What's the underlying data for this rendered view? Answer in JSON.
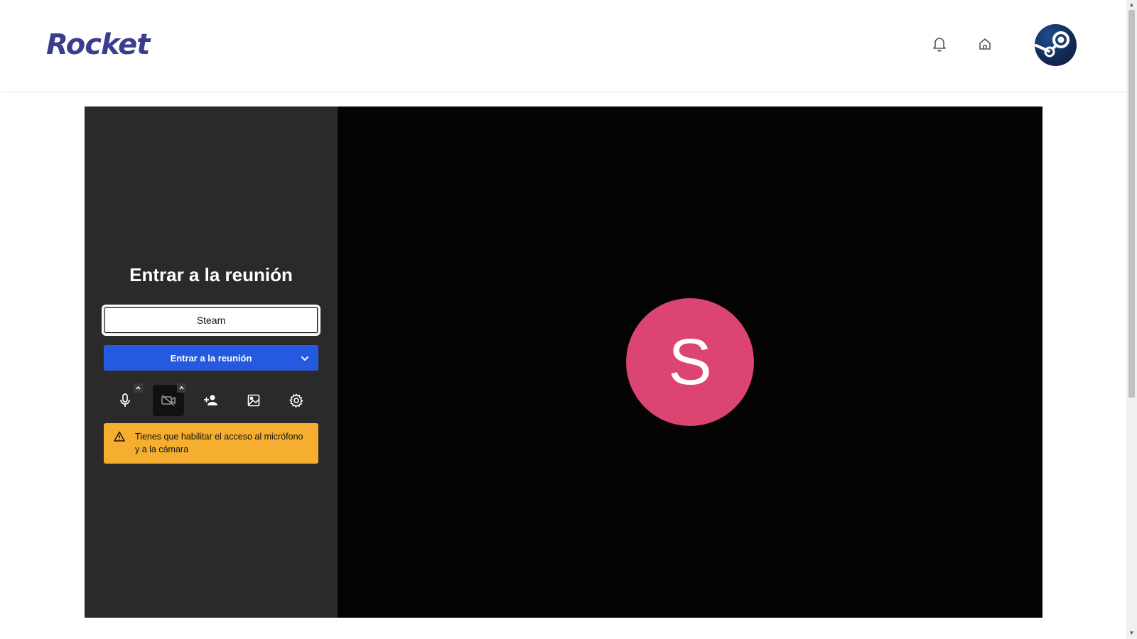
{
  "header": {
    "logo": "Rocket",
    "icons": [
      "bell-icon",
      "home-icon"
    ],
    "avatar_icon": "steam-logo-icon"
  },
  "prejoin": {
    "title": "Entrar a la reunión",
    "name_value": "Steam",
    "join_button_label": "Entrar a la reunión",
    "toolbar": [
      "microphone-icon",
      "camera-off-icon",
      "invite-person-icon",
      "virtual-background-icon",
      "settings-icon"
    ],
    "warning_text": "Tienes que habilitar el acceso al micrófono y a la cámara"
  },
  "participant": {
    "initial": "S",
    "avatar_color": "#dc4471"
  },
  "colors": {
    "brand": "#3d3d8f",
    "primary_button": "#2459e0",
    "warning": "#f5ae30",
    "panel": "#2a2a2a",
    "stage": "#040404"
  }
}
